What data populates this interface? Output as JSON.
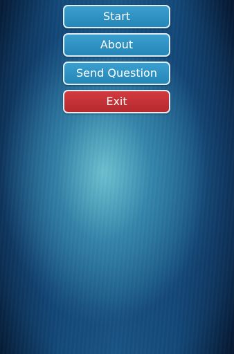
{
  "menu": {
    "start_label": "Start",
    "about_label": "About",
    "send_question_label": "Send Question",
    "exit_label": "Exit"
  },
  "colors": {
    "primary_button": "#2e93c4",
    "exit_button": "#c23338",
    "button_border": "#dceef7",
    "background_dark": "#0d2a4a",
    "background_light": "#6fc6d4"
  }
}
